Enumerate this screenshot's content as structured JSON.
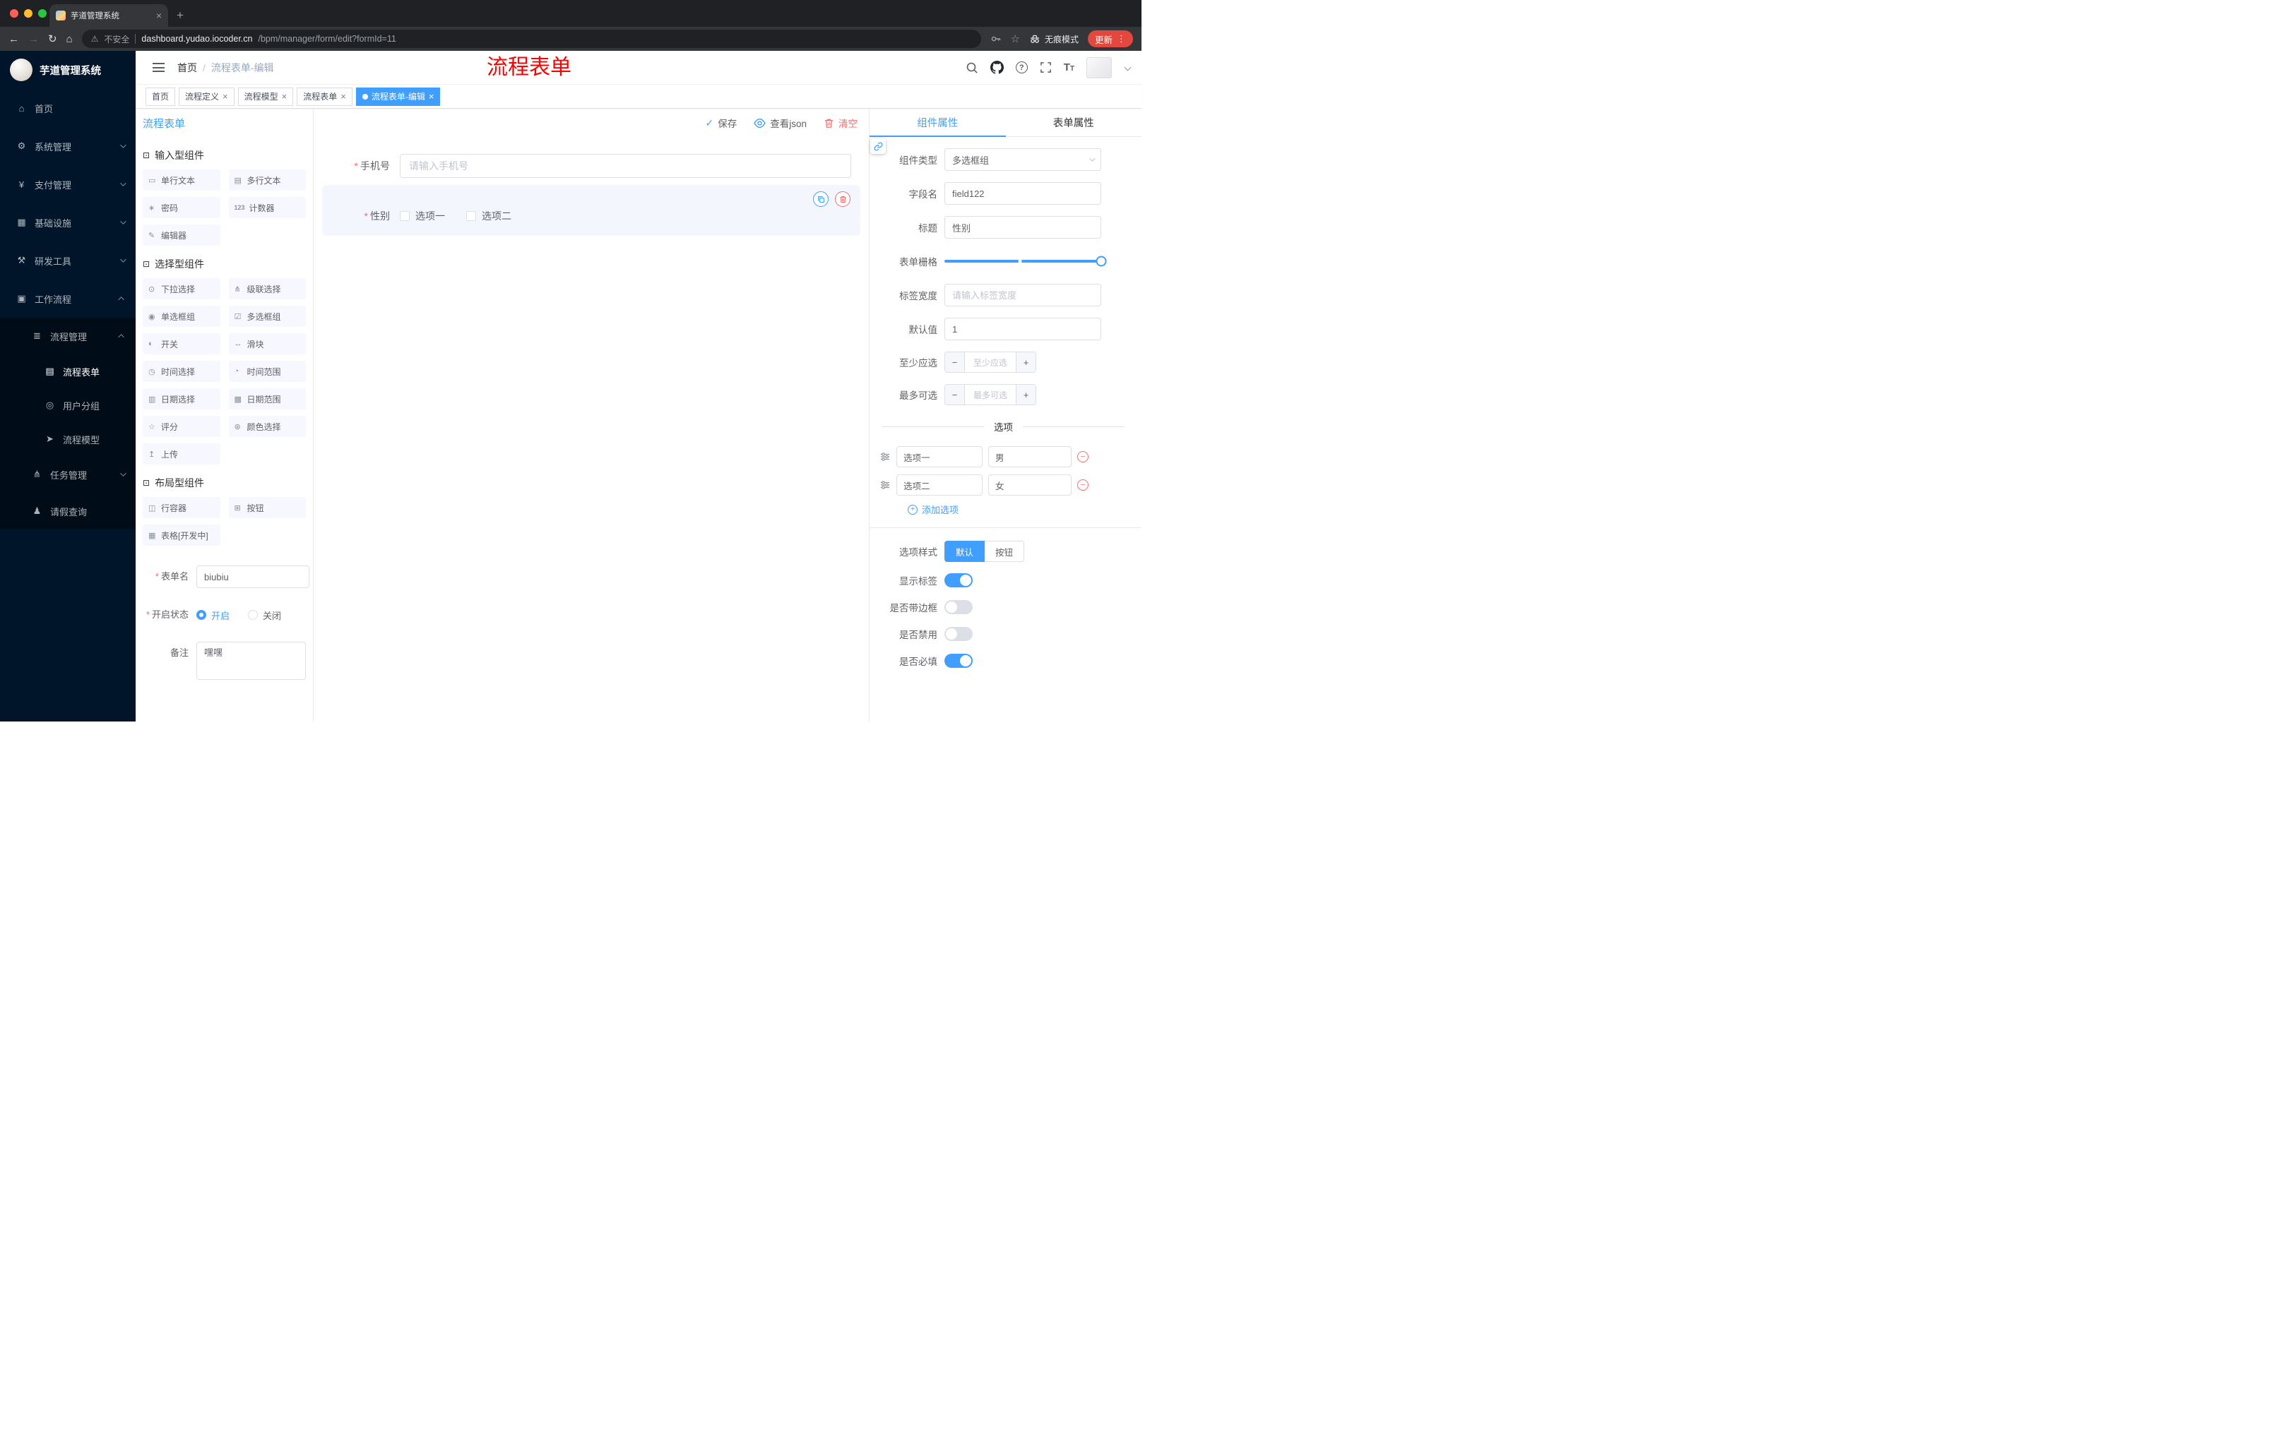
{
  "colors": {
    "accent": "#409eff",
    "danger": "#f56c6c",
    "annotation_red": "#ff0000",
    "sidebar_bg": "#001529",
    "update_chip": "#e2483d",
    "palette_item_bg": "#f6f7ff",
    "selected_block_bg": "#f4f6fe"
  },
  "icons": {
    "close": "×",
    "plus": "+",
    "minus": "−",
    "more_vert": "⋮",
    "check": "✓",
    "back": "←",
    "forward": "→",
    "reload": "↻",
    "home_nav": "⌂",
    "star": "☆",
    "warning": "⚠",
    "question": "?",
    "required": "*",
    "slash": "/",
    "text_size_big": "T",
    "text_size_small": "T",
    "new_tab": "+"
  },
  "browser": {
    "tab_title": "芋道管理系统",
    "security_label": "不安全",
    "url_host": "dashboard.yudao.iocoder.cn",
    "url_path": "/bpm/manager/form/edit?formId=11",
    "incognito_label": "无痕模式",
    "update_label": "更新"
  },
  "sidebar": {
    "logo_title": "芋道管理系统",
    "items": [
      {
        "icon": "⌂",
        "label": "首页"
      },
      {
        "icon": "⚙",
        "label": "系统管理"
      },
      {
        "icon": "¥",
        "label": "支付管理"
      },
      {
        "icon": "▦",
        "label": "基础设施"
      },
      {
        "icon": "⚒",
        "label": "研发工具"
      },
      {
        "icon": "▣",
        "label": "工作流程"
      },
      {
        "icon": "≣",
        "label": "流程管理"
      },
      {
        "icon": "▤",
        "label": "流程表单"
      },
      {
        "icon": "◎",
        "label": "用户分组"
      },
      {
        "icon": "➤",
        "label": "流程模型"
      },
      {
        "icon": "⋔",
        "label": "任务管理"
      },
      {
        "icon": "♟",
        "label": "请假查询"
      }
    ]
  },
  "navbar": {
    "breadcrumb_home": "首页",
    "breadcrumb_current": "流程表单-编辑",
    "annotation": "流程表单"
  },
  "tags": [
    {
      "label": "首页"
    },
    {
      "label": "流程定义"
    },
    {
      "label": "流程模型"
    },
    {
      "label": "流程表单"
    },
    {
      "label": "流程表单-编辑"
    }
  ],
  "designer": {
    "title": "流程表单",
    "save_label": "保存",
    "json_label": "查看json",
    "clear_label": "清空",
    "groups": [
      {
        "title": "输入型组件",
        "icon": "⊡",
        "items": [
          {
            "icon": "▭",
            "label": "单行文本"
          },
          {
            "icon": "▤",
            "label": "多行文本"
          },
          {
            "icon": "∗",
            "label": "密码"
          },
          {
            "icon": "123",
            "label": "计数器"
          },
          {
            "icon": "✎",
            "label": "编辑器"
          }
        ]
      },
      {
        "title": "选择型组件",
        "icon": "⊡",
        "items": [
          {
            "icon": "⊙",
            "label": "下拉选择"
          },
          {
            "icon": "⋔",
            "label": "级联选择"
          },
          {
            "icon": "◉",
            "label": "单选框组"
          },
          {
            "icon": "☑",
            "label": "多选框组"
          },
          {
            "icon": "◐",
            "label": "开关"
          },
          {
            "icon": "↔",
            "label": "滑块"
          },
          {
            "icon": "◷",
            "label": "时间选择"
          },
          {
            "icon": "◔",
            "label": "时间范围"
          },
          {
            "icon": "▥",
            "label": "日期选择"
          },
          {
            "icon": "▩",
            "label": "日期范围"
          },
          {
            "icon": "☆",
            "label": "评分"
          },
          {
            "icon": "⊛",
            "label": "颜色选择"
          },
          {
            "icon": "↥",
            "label": "上传"
          }
        ]
      },
      {
        "title": "布局型组件",
        "icon": "⊡",
        "items": [
          {
            "icon": "◫",
            "label": "行容器"
          },
          {
            "icon": "⊞",
            "label": "按钮"
          },
          {
            "icon": "▦",
            "label": "表格[开发中]"
          }
        ]
      }
    ],
    "meta": {
      "name_label": "表单名",
      "name_value": "biubiu",
      "status_label": "开启状态",
      "status_on": "开启",
      "status_off": "关闭",
      "remark_label": "备注",
      "remark_value": "嘿嘿"
    }
  },
  "canvas": {
    "phone_label": "手机号",
    "phone_placeholder": "请输入手机号",
    "gender_label": "性别",
    "gender_opt1": "选项一",
    "gender_opt2": "选项二"
  },
  "props": {
    "tab_component": "组件属性",
    "tab_form": "表单属性",
    "type_label": "组件类型",
    "type_value": "多选框组",
    "field_label": "字段名",
    "field_value": "field122",
    "title_label": "标题",
    "title_value": "性别",
    "grid_label": "表单栅格",
    "width_label": "标签宽度",
    "width_placeholder": "请输入标签宽度",
    "default_label": "默认值",
    "default_value": "1",
    "min_label": "至少应选",
    "min_placeholder": "至少应选",
    "max_label": "最多可选",
    "max_placeholder": "最多可选",
    "options_title": "选项",
    "options": [
      {
        "label": "选项一",
        "value": "男"
      },
      {
        "label": "选项二",
        "value": "女"
      }
    ],
    "add_option": "添加选项",
    "style_label": "选项样式",
    "style_default": "默认",
    "style_button": "按钮",
    "switch_show_label": "显示标签",
    "switch_border": "是否带边框",
    "switch_disabled": "是否禁用",
    "switch_required": "是否必填"
  }
}
